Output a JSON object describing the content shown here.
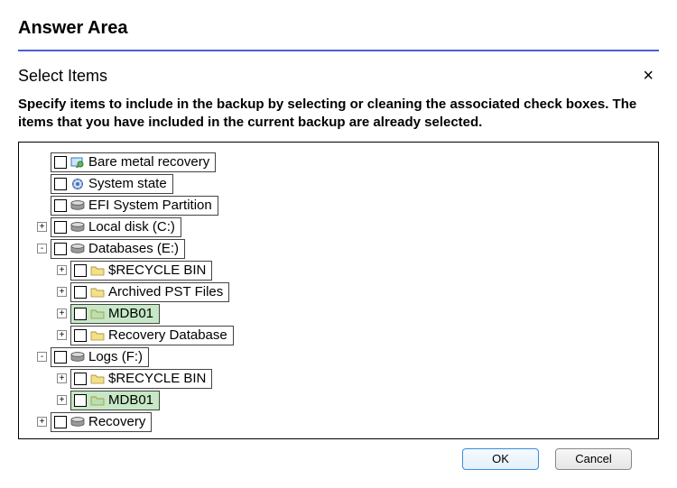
{
  "header": {
    "title": "Answer Area"
  },
  "dialog": {
    "title": "Select Items",
    "close": "×",
    "instructions": "Specify items to include in the backup by selecting or cleaning the associated check boxes. The items that you have included in the current backup are already selected."
  },
  "tree": [
    {
      "indent": 0,
      "expander": "",
      "icon": "recovery",
      "label": "Bare metal recovery",
      "highlight": false
    },
    {
      "indent": 0,
      "expander": "",
      "icon": "state",
      "label": "System state",
      "highlight": false
    },
    {
      "indent": 0,
      "expander": "",
      "icon": "disk",
      "label": "EFI System Partition",
      "highlight": false
    },
    {
      "indent": 0,
      "expander": "+",
      "icon": "disk",
      "label": "Local disk (C:)",
      "highlight": false
    },
    {
      "indent": 0,
      "expander": "-",
      "icon": "disk",
      "label": "Databases (E:)",
      "highlight": false
    },
    {
      "indent": 1,
      "expander": "+",
      "icon": "folder",
      "label": "$RECYCLE BIN",
      "highlight": false
    },
    {
      "indent": 1,
      "expander": "+",
      "icon": "folder",
      "label": "Archived PST Files",
      "highlight": false
    },
    {
      "indent": 1,
      "expander": "+",
      "icon": "folder-g",
      "label": "MDB01",
      "highlight": true
    },
    {
      "indent": 1,
      "expander": "+",
      "icon": "folder",
      "label": "Recovery Database",
      "highlight": false
    },
    {
      "indent": 0,
      "expander": "-",
      "icon": "disk",
      "label": "Logs (F:)",
      "highlight": false
    },
    {
      "indent": 1,
      "expander": "+",
      "icon": "folder",
      "label": "$RECYCLE BIN",
      "highlight": false
    },
    {
      "indent": 1,
      "expander": "+",
      "icon": "folder-g",
      "label": "MDB01",
      "highlight": true
    },
    {
      "indent": 0,
      "expander": "+",
      "icon": "disk",
      "label": "Recovery",
      "highlight": false
    }
  ],
  "buttons": {
    "ok": "OK",
    "cancel": "Cancel"
  }
}
